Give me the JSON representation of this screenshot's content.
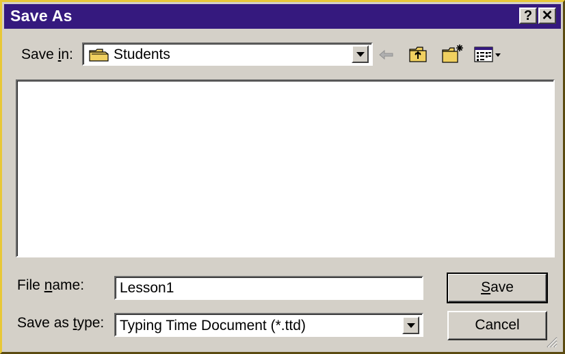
{
  "window": {
    "title": "Save As"
  },
  "title_buttons": {
    "help": "?",
    "close": "✕"
  },
  "save_in": {
    "label_pre": "Save ",
    "label_accel": "i",
    "label_post": "n:",
    "value": "Students",
    "folder_icon": "folder-icon"
  },
  "toolbar": {
    "icons": [
      "back-arrow-icon",
      "up-one-level-icon",
      "new-folder-icon",
      "view-menu-icon"
    ]
  },
  "file_name": {
    "label_pre": "File ",
    "label_accel": "n",
    "label_post": "ame:",
    "value": "Lesson1"
  },
  "save_as_type": {
    "label_pre": "Save as ",
    "label_accel": "t",
    "label_post": "ype:",
    "value": "Typing Time Document (*.ttd)"
  },
  "buttons": {
    "save_accel": "S",
    "save_rest": "ave",
    "cancel": "Cancel"
  },
  "colors": {
    "titlebar": "#35197e",
    "face": "#d4d0c8",
    "folder": "#f0d060"
  }
}
